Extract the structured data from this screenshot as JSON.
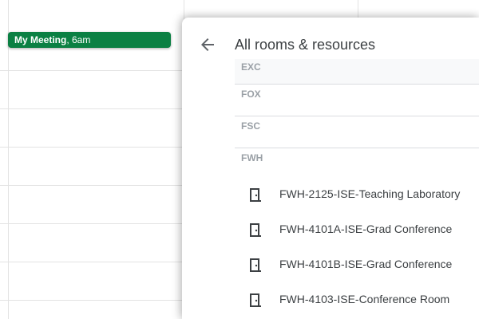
{
  "calendar": {
    "event": {
      "title": "My Meeting",
      "time": ", 6am",
      "color": "#0b8043"
    }
  },
  "panel": {
    "title": "All rooms & resources",
    "back_icon": "arrow-left-icon",
    "groups": [
      {
        "label": "EXC"
      },
      {
        "label": "FOX"
      },
      {
        "label": "FSC"
      },
      {
        "label": "FWH"
      }
    ],
    "rooms": [
      {
        "icon": "door-icon",
        "label": "FWH-2125-ISE-Teaching Laboratory"
      },
      {
        "icon": "door-icon",
        "label": "FWH-4101A-ISE-Grad Conference"
      },
      {
        "icon": "door-icon",
        "label": "FWH-4101B-ISE-Grad Conference"
      },
      {
        "icon": "door-icon",
        "label": "FWH-4103-ISE-Conference Room"
      }
    ]
  }
}
